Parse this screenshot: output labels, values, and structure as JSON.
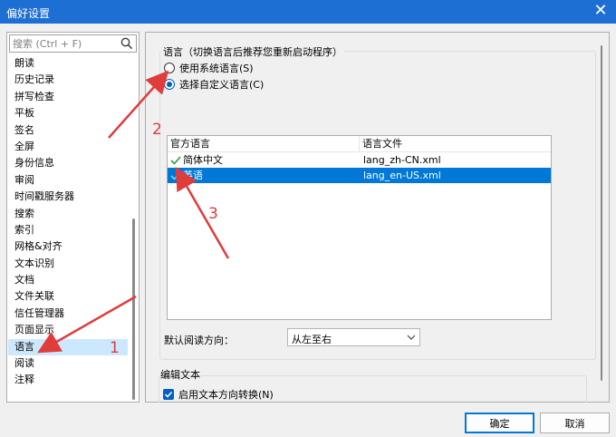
{
  "window": {
    "title": "偏好设置",
    "close_symbol": "✕"
  },
  "sidebar": {
    "search_placeholder": "搜索 (Ctrl + F)",
    "items": [
      {
        "label": "朗读"
      },
      {
        "label": "历史记录"
      },
      {
        "label": "拼写检查"
      },
      {
        "label": "平板"
      },
      {
        "label": "签名"
      },
      {
        "label": "全屏"
      },
      {
        "label": "身份信息"
      },
      {
        "label": "审阅"
      },
      {
        "label": "时间戳服务器"
      },
      {
        "label": "搜索"
      },
      {
        "label": "索引"
      },
      {
        "label": "网格&对齐"
      },
      {
        "label": "文本识别"
      },
      {
        "label": "文档"
      },
      {
        "label": "文件关联"
      },
      {
        "label": "信任管理器"
      },
      {
        "label": "页面显示"
      },
      {
        "label": "语言",
        "selected": true
      },
      {
        "label": "阅读"
      },
      {
        "label": "注释"
      }
    ]
  },
  "language_group": {
    "title": "语言（切换语言后推荐您重新启动程序）",
    "option_system": "使用系统语言(S)",
    "option_custom": "选择自定义语言(C)",
    "selected_option": "custom"
  },
  "language_table": {
    "headers": [
      "官方语言",
      "语言文件"
    ],
    "rows": [
      {
        "language": "简体中文",
        "file": "lang_zh-CN.xml",
        "selected": false
      },
      {
        "language": "英语",
        "file": "lang_en-US.xml",
        "selected": true
      }
    ]
  },
  "reading_direction": {
    "label": "默认阅读方向：",
    "value": "从左至右"
  },
  "edit_text_group": {
    "title": "编辑文本",
    "checkbox_label": "启用文本方向转换(N)",
    "checked": true
  },
  "buttons": {
    "ok": "确定",
    "cancel": "取消"
  },
  "annotations": {
    "numbers": [
      "1",
      "2",
      "3"
    ],
    "color": "#e03c3c"
  },
  "colors": {
    "titlebar": "#1e6fd3",
    "selection": "#0078d7",
    "sidebar_selection": "#cce8ff",
    "check_green": "#2e9d3a",
    "check_teal": "#3aa3c7"
  }
}
